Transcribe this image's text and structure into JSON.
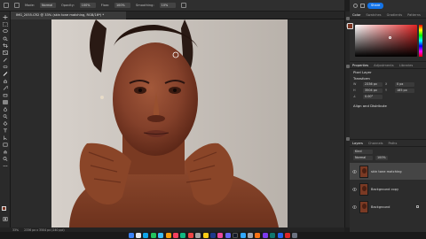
{
  "window": {
    "doc_tab": "IMG_2055.CR2 @ 33% (skin tone matching, RGB/16*) *"
  },
  "options_bar": {
    "mode_label": "Mode:",
    "mode_value": "Normal",
    "opacity_label": "Opacity:",
    "opacity_value": "100%",
    "flow_label": "Flow:",
    "flow_value": "100%",
    "smoothing_label": "Smoothing:",
    "smoothing_value": "10%"
  },
  "topright": {
    "share_label": "Share"
  },
  "color_panel": {
    "tabs": [
      "Color",
      "Swatches",
      "Gradients",
      "Patterns"
    ],
    "active_tab": "Color"
  },
  "properties_panel": {
    "tabs": [
      "Properties",
      "Adjustments",
      "Libraries"
    ],
    "layer_type": "Pixel Layer",
    "transform_header": "Transform",
    "w_label": "W",
    "w_value": "2336 px",
    "x_label": "X",
    "x_value": "0 px",
    "h_label": "H",
    "h_value": "3504 px",
    "y_label": "Y",
    "y_value": "185 px",
    "angle_value": "0.00°",
    "align_header": "Align and Distribute"
  },
  "layers_panel": {
    "tabs": [
      "Layers",
      "Channels",
      "Paths"
    ],
    "kind_label": "Kind",
    "blend_mode": "Normal",
    "opacity_value": "100%",
    "layers": [
      {
        "name": "skin tone matching",
        "selected": true
      },
      {
        "name": "Background copy",
        "selected": false
      },
      {
        "name": "Background",
        "selected": false
      }
    ]
  },
  "status": {
    "zoom": "33%",
    "doc_info": "2336 px x 3504 px (240 ppi)"
  },
  "colors": {
    "accent": "#1473e6",
    "skin": "#8a4428",
    "backdrop": "#c8c2bc"
  }
}
